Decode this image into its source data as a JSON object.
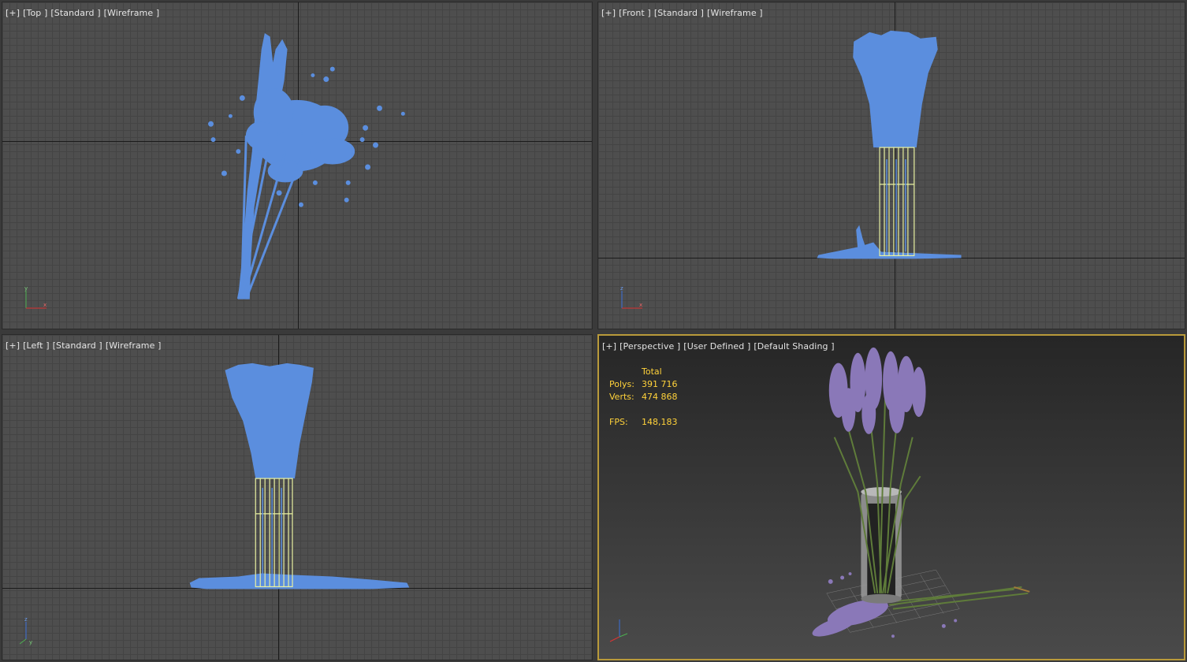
{
  "viewports": {
    "top": {
      "labels": [
        "[+]",
        "[Top ]",
        "[Standard ]",
        "[Wireframe ]"
      ],
      "gizmo_axes": [
        "y",
        "x"
      ]
    },
    "front": {
      "labels": [
        "[+]",
        "[Front ]",
        "[Standard ]",
        "[Wireframe ]"
      ],
      "gizmo_axes": [
        "z",
        "x"
      ]
    },
    "left": {
      "labels": [
        "[+]",
        "[Left ]",
        "[Standard ]",
        "[Wireframe ]"
      ],
      "gizmo_axes": [
        "z",
        "y"
      ]
    },
    "perspective": {
      "labels": [
        "[+]",
        "[Perspective ]",
        "[User Defined ]",
        "[Default Shading ]"
      ],
      "stats": {
        "header": "Total",
        "polys_label": "Polys:",
        "polys_value": "391 716",
        "verts_label": "Verts:",
        "verts_value": "474 868",
        "fps_label": "FPS:",
        "fps_value": "148,183"
      }
    }
  },
  "colors": {
    "wire_object": "#5b8ede",
    "selected_vase": "#e8f0a0",
    "active_border": "#b99a3a",
    "stats_text": "#ffd23a",
    "lavender": "#8a78b8",
    "stem_green": "#5f7c3a"
  }
}
